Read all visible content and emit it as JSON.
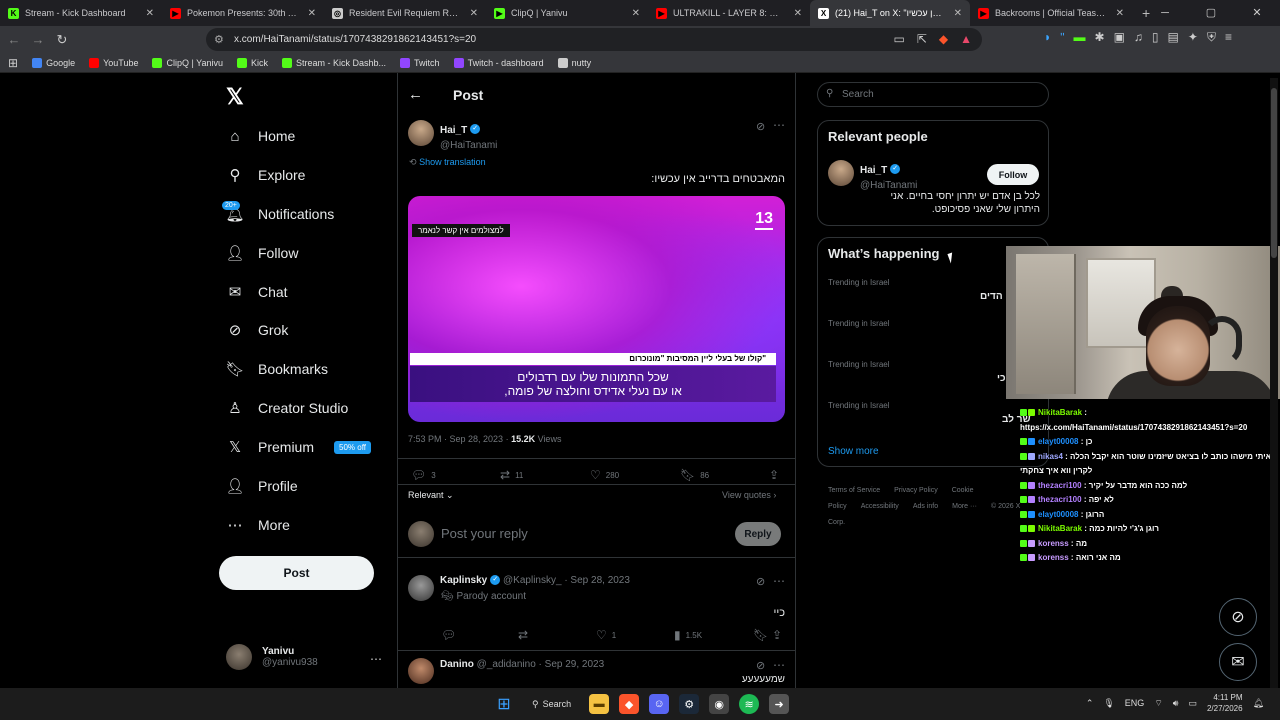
{
  "browser": {
    "tabs": [
      {
        "title": "Stream - Kick Dashboard",
        "color": "#53fc18",
        "glyph": "K"
      },
      {
        "title": "Pokemon Presents: 30th Anniversary",
        "color": "#ff0000",
        "glyph": "▶"
      },
      {
        "title": "Resident Evil Requiem Reviews - Met",
        "color": "#cccccc",
        "glyph": "◎"
      },
      {
        "title": "ClipQ | Yanivu",
        "color": "#53fc18",
        "glyph": "▶"
      },
      {
        "title": "ULTRAKILL - LAYER 8: FRAUD - OUT",
        "color": "#ff0000",
        "glyph": "▶"
      },
      {
        "title": "(21) Hai_T on X: \"המאבטחים בדרייב אין עכשיו\"",
        "color": "#ffffff",
        "glyph": "X",
        "active": true
      },
      {
        "title": "Backrooms | Official Teaser HD | A24",
        "color": "#ff0000",
        "glyph": "▶"
      }
    ],
    "new_tab": "+",
    "url": "x.com/HaiTanami/status/1707438291862143451?s=20",
    "bookmarks": [
      {
        "label": "Google",
        "color": "#4285f4"
      },
      {
        "label": "YouTube",
        "color": "#ff0000"
      },
      {
        "label": "ClipQ | Yanivu",
        "color": "#53fc18"
      },
      {
        "label": "Kick",
        "color": "#53fc18"
      },
      {
        "label": "Stream - Kick Dashb...",
        "color": "#53fc18"
      },
      {
        "label": "Twitch",
        "color": "#9146ff"
      },
      {
        "label": "Twitch - dashboard",
        "color": "#9146ff"
      },
      {
        "label": "nutty",
        "color": "#cccccc"
      }
    ]
  },
  "nav": {
    "items": [
      {
        "label": "Home",
        "icon": "home-icon",
        "glyph": "⌂"
      },
      {
        "label": "Explore",
        "icon": "search-icon",
        "glyph": "⚲"
      },
      {
        "label": "Notifications",
        "icon": "bell-icon",
        "glyph": "🔔︎"
      },
      {
        "label": "Follow",
        "icon": "follow-icon",
        "glyph": "👤︎"
      },
      {
        "label": "Chat",
        "icon": "mail-icon",
        "glyph": "✉"
      },
      {
        "label": "Grok",
        "icon": "grok-icon",
        "glyph": "⊘"
      },
      {
        "label": "Bookmarks",
        "icon": "bookmark-icon",
        "glyph": "🔖︎"
      },
      {
        "label": "Creator Studio",
        "icon": "creator-icon",
        "glyph": "♙"
      },
      {
        "label": "Premium",
        "icon": "x-icon",
        "glyph": "𝕏"
      },
      {
        "label": "Profile",
        "icon": "profile-icon",
        "glyph": "👤︎"
      },
      {
        "label": "More",
        "icon": "more-icon",
        "glyph": "⋯"
      }
    ],
    "notifications_badge": "20+",
    "premium_badge": "50% off",
    "post_button": "Post",
    "me": {
      "name": "Yanivu",
      "handle": "@yanivu938"
    }
  },
  "post": {
    "header": "Post",
    "author": {
      "name": "Hai_T",
      "handle": "@HaiTanami"
    },
    "show_translation": "Show translation",
    "text": "המאבטחים בדרייב אין עכשיו:",
    "media": {
      "channel": "13",
      "top_caption": "למצולמים אין קשר לנאמר",
      "band_title": "קולו של בעלי ליין המסיבות \"מונוכרום\"",
      "band_text_1": "שכל התמונות שלו עם רדבולים",
      "band_text_2": "או עם נעלי אדידס וחולצה של פומה,"
    },
    "timestamp": "7:53 PM · Sep 28, 2023 · ",
    "views_count": "15.2K",
    "views_label": " Views",
    "stats": {
      "replies": "3",
      "reposts": "11",
      "likes": "280",
      "bookmarks": "86"
    },
    "sort": "Relevant",
    "view_quotes": "View quotes",
    "reply_placeholder": "Post your reply",
    "reply_button": "Reply"
  },
  "replies": [
    {
      "name": "Kaplinsky",
      "handle": "@Kaplinsky_",
      "date": "· Sep 28, 2023",
      "sub": "Parody account",
      "text": "כיי",
      "likes": "1",
      "views": "1.5K"
    },
    {
      "name": "Danino",
      "handle": "@_adidanino",
      "date": "· Sep 29, 2023",
      "text": "שמעעעעע"
    }
  ],
  "sidebar": {
    "search_placeholder": "Search",
    "relevant_title": "Relevant people",
    "person": {
      "name": "Hai_T",
      "handle": "@HaiTanami",
      "bio_1": "לכל בן אדם יש יתרון יחסי בחיים. אני",
      "bio_2": "היתרון שלי שאני פסיכופט."
    },
    "follow_label": "Follow",
    "happening_title": "What’s happening",
    "trend_label": "Trending in Israel",
    "trend_fragments": [
      "הדים",
      "כי",
      "שר לב"
    ],
    "show_more": "Show more",
    "footer": [
      "Terms of Service",
      "Privacy Policy",
      "Cookie Policy",
      "Accessibility",
      "Ads info",
      "More ···",
      "© 2026 X Corp."
    ]
  },
  "chat": [
    {
      "user": "NikitaBarak",
      "color": "#7cfc00",
      "msg": ":"
    },
    {
      "user": "",
      "color": "#ffffff",
      "msg": "https://x.com/HaiTanami/status/1707438291862143451?s=20"
    },
    {
      "user": "elayt00008",
      "color": "#1e90ff",
      "msg": ": כן"
    },
    {
      "user": "nikas4",
      "color": "#9fa8ff",
      "msg": ": ראיתי מישהו כותב לו בציאט שיזמינו שוטר הוא יקבל הכלה"
    },
    {
      "user": "",
      "color": "#ffffff",
      "msg": "לקרין ווא איך צחקתי"
    },
    {
      "user": "thezacri100",
      "color": "#b380ff",
      "msg": ": למה ככה הוא מדבר על יקיר"
    },
    {
      "user": "thezacri100",
      "color": "#b380ff",
      "msg": ": לא יפה"
    },
    {
      "user": "elayt00008",
      "color": "#1e90ff",
      "msg": ": הרוגן"
    },
    {
      "user": "NikitaBarak",
      "color": "#7cfc00",
      "msg": ": רוגן ג'ג'י להיות כמה"
    },
    {
      "user": "korenss",
      "color": "#c89bff",
      "msg": ": מה"
    },
    {
      "user": "korenss",
      "color": "#c89bff",
      "msg": ": מה אני רואה"
    }
  ],
  "taskbar": {
    "search_label": "Search",
    "lang": "ENG",
    "time": "4:11 PM",
    "date": "2/27/2026"
  }
}
